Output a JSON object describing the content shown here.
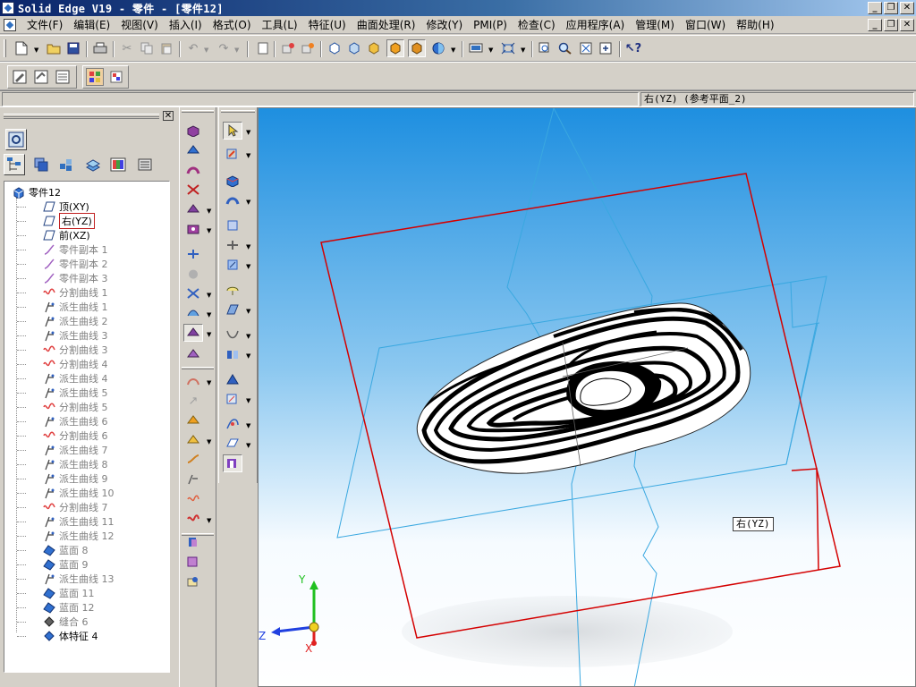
{
  "window": {
    "title": "Solid Edge V19 - 零件 - [零件12]",
    "controls": [
      "_",
      "❐",
      "✕"
    ]
  },
  "menu": {
    "items": [
      "文件(F)",
      "编辑(E)",
      "视图(V)",
      "插入(I)",
      "格式(O)",
      "工具(L)",
      "特征(U)",
      "曲面处理(R)",
      "修改(Y)",
      "PMI(P)",
      "检查(C)",
      "应用程序(A)",
      "管理(M)",
      "窗口(W)",
      "帮助(H)"
    ],
    "controls": [
      "_",
      "❐",
      "✕"
    ]
  },
  "status": {
    "prompt": "",
    "selection": "右(YZ) (参考平面_2)"
  },
  "pathfinder": {
    "close": "✕",
    "tree": [
      {
        "label": "零件12",
        "icon": "part-icon",
        "level": 0,
        "dim": false
      },
      {
        "label": "顶(XY)",
        "icon": "plane-icon",
        "level": 1,
        "dim": false
      },
      {
        "label": "右(YZ)",
        "icon": "plane-icon",
        "level": 1,
        "dim": false,
        "selected": true
      },
      {
        "label": "前(XZ)",
        "icon": "plane-icon",
        "level": 1,
        "dim": false
      },
      {
        "label": "零件副本 1",
        "icon": "copy-curve-icon",
        "level": 1,
        "dim": true
      },
      {
        "label": "零件副本 2",
        "icon": "copy-curve-icon",
        "level": 1,
        "dim": true
      },
      {
        "label": "零件副本 3",
        "icon": "copy-curve-icon",
        "level": 1,
        "dim": true
      },
      {
        "label": "分割曲线 1",
        "icon": "split-curve-icon",
        "level": 1,
        "dim": true
      },
      {
        "label": "派生曲线 1",
        "icon": "derived-curve-icon",
        "level": 1,
        "dim": true
      },
      {
        "label": "派生曲线 2",
        "icon": "derived-curve-icon",
        "level": 1,
        "dim": true
      },
      {
        "label": "派生曲线 3",
        "icon": "derived-curve-icon",
        "level": 1,
        "dim": true
      },
      {
        "label": "分割曲线 3",
        "icon": "split-curve-icon",
        "level": 1,
        "dim": true
      },
      {
        "label": "分割曲线 4",
        "icon": "split-curve-icon",
        "level": 1,
        "dim": true
      },
      {
        "label": "派生曲线 4",
        "icon": "derived-curve-icon",
        "level": 1,
        "dim": true
      },
      {
        "label": "派生曲线 5",
        "icon": "derived-curve-icon",
        "level": 1,
        "dim": true
      },
      {
        "label": "分割曲线 5",
        "icon": "split-curve-icon",
        "level": 1,
        "dim": true
      },
      {
        "label": "派生曲线 6",
        "icon": "derived-curve-icon",
        "level": 1,
        "dim": true
      },
      {
        "label": "分割曲线 6",
        "icon": "split-curve-icon",
        "level": 1,
        "dim": true
      },
      {
        "label": "派生曲线 7",
        "icon": "derived-curve-icon",
        "level": 1,
        "dim": true
      },
      {
        "label": "派生曲线 8",
        "icon": "derived-curve-icon",
        "level": 1,
        "dim": true
      },
      {
        "label": "派生曲线 9",
        "icon": "derived-curve-icon",
        "level": 1,
        "dim": true
      },
      {
        "label": "派生曲线 10",
        "icon": "derived-curve-icon",
        "level": 1,
        "dim": true
      },
      {
        "label": "分割曲线 7",
        "icon": "split-curve-icon",
        "level": 1,
        "dim": true
      },
      {
        "label": "派生曲线 11",
        "icon": "derived-curve-icon",
        "level": 1,
        "dim": true
      },
      {
        "label": "派生曲线 12",
        "icon": "derived-curve-icon",
        "level": 1,
        "dim": true
      },
      {
        "label": "蓝面 8",
        "icon": "bluesurf-icon",
        "level": 1,
        "dim": true
      },
      {
        "label": "蓝面 9",
        "icon": "bluesurf-icon",
        "level": 1,
        "dim": true
      },
      {
        "label": "派生曲线 13",
        "icon": "derived-curve-icon",
        "level": 1,
        "dim": true
      },
      {
        "label": "蓝面 11",
        "icon": "bluesurf-icon",
        "level": 1,
        "dim": true
      },
      {
        "label": "蓝面 12",
        "icon": "bluesurf-icon",
        "level": 1,
        "dim": true
      },
      {
        "label": "缝合 6",
        "icon": "stitch-icon",
        "level": 1,
        "dim": true
      },
      {
        "label": "体特征 4",
        "icon": "body-feature-icon",
        "level": 1,
        "dim": false
      }
    ]
  },
  "viewport": {
    "plane_label": "右(YZ)",
    "triad": {
      "y": "Y",
      "z": "Z",
      "x": "X"
    }
  },
  "colors": {
    "title_bar": "#0a246a",
    "chrome": "#d4d0c8",
    "viewport_top": "#1e8fe0",
    "viewport_bottom": "#ffffff",
    "plane_selected": "#d40000",
    "plane_reference": "#3aa8e0"
  }
}
